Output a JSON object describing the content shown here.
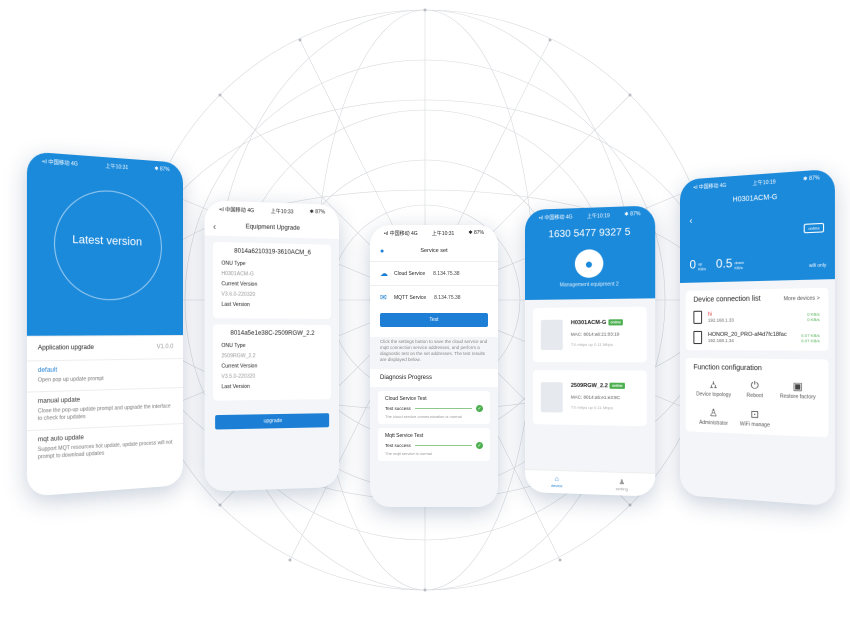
{
  "phone1": {
    "status_left": "•ıl 中国移动 4G",
    "status_time": "上午10:31",
    "status_right": "✱ 87%",
    "hero_title": "Latest version",
    "upgrade_label": "Application upgrade",
    "upgrade_version": "V1.0.0",
    "sections": [
      {
        "title": "default",
        "desc": "Open pop up update prompt"
      },
      {
        "title": "manual update",
        "desc": "Close the pop-up update prompt and upgrade the interface to check for updates"
      },
      {
        "title": "mqt auto update",
        "desc": "Support MQT resources hot update, update process will not prompt to download updates"
      }
    ]
  },
  "phone2": {
    "status_left": "•ıl 中国移动 4G",
    "status_time": "上午10:33",
    "status_right": "✱ 87%",
    "title": "Equipment Upgrade",
    "devices": [
      {
        "name": "8014a6210319-3610ACM_6",
        "onu_type": "ONU Type",
        "type_value": "H0301ACM-G",
        "current": "Current Version",
        "current_value": "V3.6.0-220320",
        "last": "Last Version"
      },
      {
        "name": "8014a5e1e38C-2509RGW_2.2",
        "onu_type": "ONU Type",
        "type_value": "2509RGW_2.2",
        "current": "Current Version",
        "current_value": "V3.5.0-220320",
        "last": "Last Version"
      }
    ],
    "button": "upgrade"
  },
  "phone3": {
    "status_left": "•ıl 中国移动 4G",
    "status_time": "上午10:31",
    "status_right": "✱ 87%",
    "title": "Service set",
    "user_label": "user",
    "services": [
      {
        "name": "Cloud Service",
        "ip": "8.134.75.38"
      },
      {
        "name": "MQTT Service",
        "ip": "8.134.75.38"
      }
    ],
    "button": "Test",
    "hint": "Click the settings button to save the cloud service and mqtt connection service addresses, and perform a diagnostic test on the set addresses. The test results are displayed below.",
    "progress_title": "Diagnosis Progress",
    "tests": [
      {
        "title": "Cloud Service Test",
        "result": "Test success",
        "note": "The cloud service communication is normal"
      },
      {
        "title": "Mqtt Service Test",
        "result": "Test success",
        "note": "The mqtt service is normal"
      }
    ]
  },
  "phone4": {
    "status_left": "•ıl 中国移动 4G",
    "status_time": "上午10:19",
    "status_right": "✱ 87%",
    "number": "1630 5477 9327 5",
    "equipment": "Management equipment 2",
    "devices": [
      {
        "name": "H0301ACM-G",
        "tag": "online",
        "mac": "MAC: 8014:a6:21:03:19",
        "sub": "TX-mbps   up 0.11 Mbps"
      },
      {
        "name": "2509RGW_2.2",
        "tag": "online",
        "mac": "MAC: 8014:a5:e1:e3:8C",
        "sub": "TX-mbps   up 0.11 Mbps"
      }
    ],
    "tabs": [
      {
        "icon": "home-icon",
        "label": "device"
      },
      {
        "icon": "person-icon",
        "label": "setting"
      }
    ]
  },
  "phone5": {
    "status_left": "•ıl 中国移动 4G",
    "status_time": "上午10:19",
    "status_right": "✱ 87%",
    "title": "H0301ACM-G",
    "online": "online",
    "stats": [
      {
        "value": "0",
        "unit_top": "up",
        "unit_bottom": "KB/s"
      },
      {
        "value": "0.5",
        "unit_top": "down",
        "unit_bottom": "KB/s"
      }
    ],
    "wifi": "wifi only",
    "connection_title": "Device connection list",
    "more": "More devices  >",
    "clients": [
      {
        "name": "hi",
        "ip": "192.168.1.33",
        "rate_up": "0 KB/s",
        "rate_down": "0 KB/s"
      },
      {
        "name": "HONOR_20_PRO-af4d7fc18fac",
        "ip": "192.168.1.34",
        "rate_up": "0.07 KB/s",
        "rate_down": "0.07 KB/s"
      }
    ],
    "function_title": "Function configuration",
    "functions": [
      {
        "icon": "network-icon",
        "label": "Device topology"
      },
      {
        "icon": "reboot-icon",
        "label": "Reboot"
      },
      {
        "icon": "reset-icon",
        "label": "Restore factory"
      },
      {
        "icon": "admin-icon",
        "label": "Administrator"
      },
      {
        "icon": "wifi-manage-icon",
        "label": "WiFi manage"
      }
    ]
  }
}
